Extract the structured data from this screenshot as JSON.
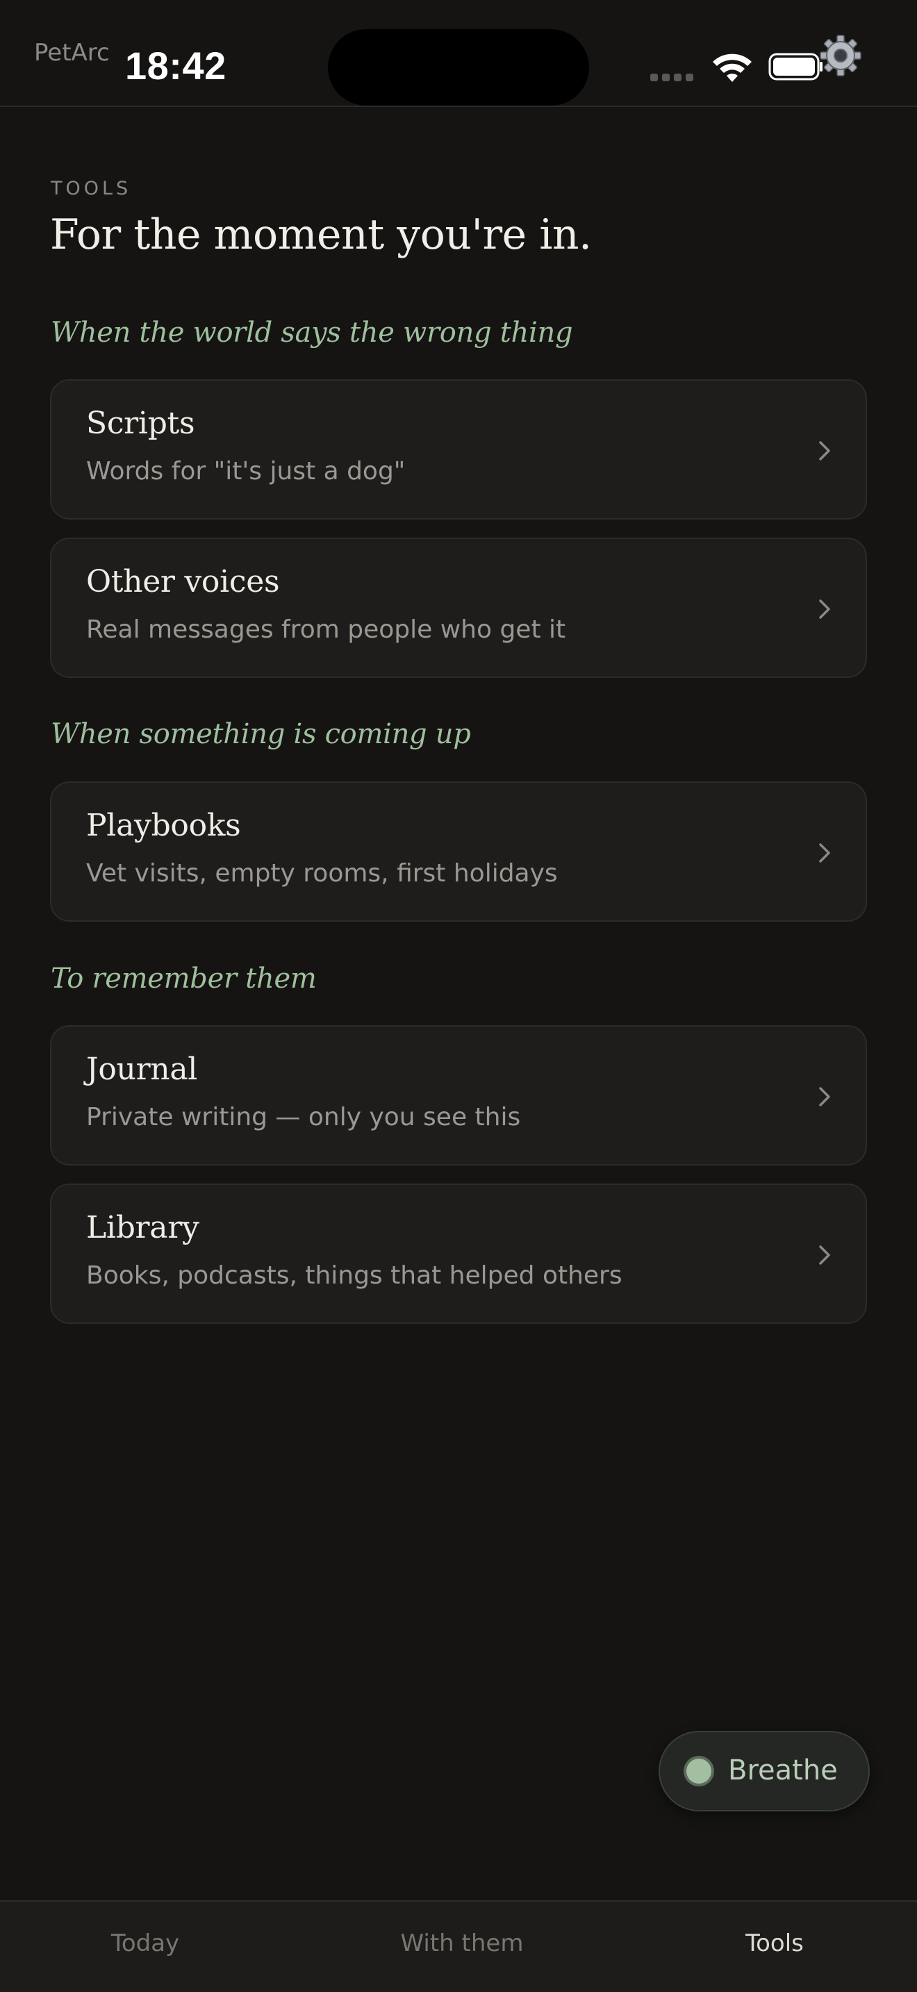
{
  "status_bar": {
    "app_name": "PetArc",
    "time": "18:42",
    "icons": [
      "signal-icon",
      "wifi-icon",
      "battery-icon",
      "gear-icon"
    ]
  },
  "header": {
    "eyebrow": "TOOLS",
    "title": "For the moment you're in."
  },
  "sections": [
    {
      "heading": "When the world says the wrong thing",
      "items": [
        {
          "title": "Scripts",
          "subtitle": "Words for \"it's just a dog\""
        },
        {
          "title": "Other voices",
          "subtitle": "Real messages from people who get it"
        }
      ]
    },
    {
      "heading": "When something is coming up",
      "items": [
        {
          "title": "Playbooks",
          "subtitle": "Vet visits, empty rooms, first holidays"
        }
      ]
    },
    {
      "heading": "To remember them",
      "items": [
        {
          "title": "Journal",
          "subtitle": "Private writing — only you see this"
        },
        {
          "title": "Library",
          "subtitle": "Books, podcasts, things that helped others"
        }
      ]
    }
  ],
  "breathe_button": {
    "label": "Breathe"
  },
  "tab_bar": {
    "tabs": [
      {
        "label": "Today",
        "active": false
      },
      {
        "label": "With them",
        "active": false
      },
      {
        "label": "Tools",
        "active": true
      }
    ]
  },
  "colors": {
    "background": "#151413",
    "card": "#1e1d1c",
    "accent_green": "#9fbf9d",
    "text_primary": "#f1ede6",
    "text_secondary": "#9b9892"
  }
}
